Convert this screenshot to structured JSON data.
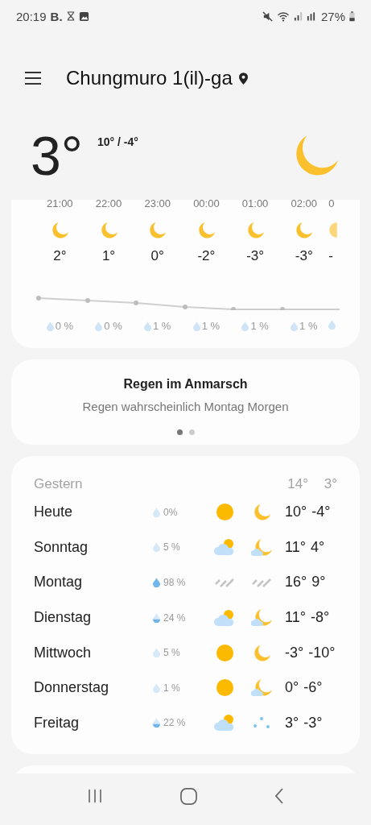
{
  "status_bar": {
    "time": "20:19",
    "app_letter": "B.",
    "battery": "27%"
  },
  "header": {
    "location": "Chungmuro 1(il)-ga"
  },
  "current": {
    "temp": "3°",
    "range": "10° / -4°",
    "icon": {
      "kind": "moon"
    }
  },
  "hourly": [
    {
      "time": "21:00",
      "icon": {
        "kind": "moon"
      },
      "temp": "2°",
      "precip": "0 %"
    },
    {
      "time": "22:00",
      "icon": {
        "kind": "moon"
      },
      "temp": "1°",
      "precip": "0 %"
    },
    {
      "time": "23:00",
      "icon": {
        "kind": "moon"
      },
      "temp": "0°",
      "precip": "1 %"
    },
    {
      "time": "00:00",
      "icon": {
        "kind": "moon"
      },
      "temp": "-2°",
      "precip": "1 %"
    },
    {
      "time": "01:00",
      "icon": {
        "kind": "moon"
      },
      "temp": "-3°",
      "precip": "1 %"
    },
    {
      "time": "02:00",
      "icon": {
        "kind": "moon"
      },
      "temp": "-3°",
      "precip": "1 %"
    },
    {
      "time": "0",
      "icon": {
        "kind": "sun"
      },
      "temp": "-"
    }
  ],
  "alert": {
    "title": "Regen im Anmarsch",
    "text": "Regen wahrscheinlich Montag Morgen",
    "pages": [
      {
        "selected": true
      },
      {
        "selected": false
      }
    ]
  },
  "yesterday": {
    "label": "Gestern",
    "high": "14°",
    "low": "3°"
  },
  "daily": [
    {
      "day": "Heute",
      "precip": {
        "kind": "empty",
        "text": "0%"
      },
      "day_icon": {
        "kind": "sun"
      },
      "night_icon": {
        "kind": "moon"
      },
      "high": "10°",
      "low": "-4°"
    },
    {
      "day": "Sonntag",
      "precip": {
        "kind": "empty",
        "text": "5 %"
      },
      "day_icon": {
        "kind": "cloud-sun"
      },
      "night_icon": {
        "kind": "moon-cloud"
      },
      "high": "11°",
      "low": "4°"
    },
    {
      "day": "Montag",
      "precip": {
        "kind": "full",
        "text": "98 %"
      },
      "day_icon": {
        "kind": "rain"
      },
      "night_icon": {
        "kind": "rain"
      },
      "high": "16°",
      "low": "9°"
    },
    {
      "day": "Dienstag",
      "precip": {
        "kind": "half",
        "text": "24 %"
      },
      "day_icon": {
        "kind": "cloud-sun"
      },
      "night_icon": {
        "kind": "moon-cloud"
      },
      "high": "11°",
      "low": "-8°"
    },
    {
      "day": "Mittwoch",
      "precip": {
        "kind": "empty",
        "text": "5 %"
      },
      "day_icon": {
        "kind": "sun"
      },
      "night_icon": {
        "kind": "moon"
      },
      "high": "-3°",
      "low": "-10°"
    },
    {
      "day": "Donnerstag",
      "precip": {
        "kind": "empty",
        "text": "1 %"
      },
      "day_icon": {
        "kind": "sun"
      },
      "night_icon": {
        "kind": "moon-cloud"
      },
      "high": "0°",
      "low": "-6°"
    },
    {
      "day": "Freitag",
      "precip": {
        "kind": "half",
        "text": "22 %"
      },
      "day_icon": {
        "kind": "cloud-sun"
      },
      "night_icon": {
        "kind": "snow"
      },
      "high": "3°",
      "low": "-3°"
    }
  ]
}
